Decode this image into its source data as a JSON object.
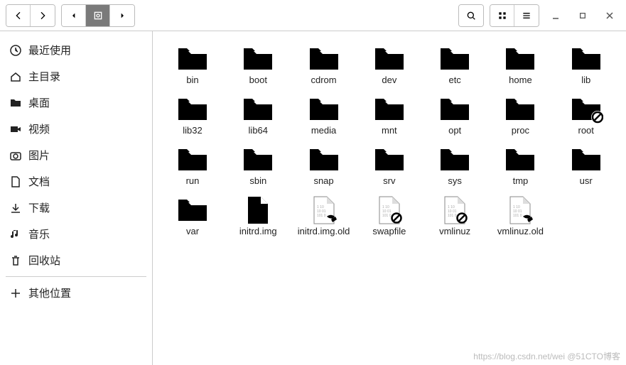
{
  "toolbar": {
    "back": "back",
    "forward": "forward",
    "path_prev": "prev",
    "path_current": "root",
    "path_next": "next",
    "search": "search",
    "view_grid": "grid",
    "menu": "menu",
    "minimize": "minimize",
    "maximize": "maximize",
    "close": "close"
  },
  "sidebar": {
    "items": [
      {
        "id": "recent",
        "icon": "clock",
        "label": "最近使用"
      },
      {
        "id": "home",
        "icon": "home",
        "label": "主目录"
      },
      {
        "id": "desktop",
        "icon": "folder",
        "label": "桌面"
      },
      {
        "id": "videos",
        "icon": "video",
        "label": "视频"
      },
      {
        "id": "pictures",
        "icon": "camera",
        "label": "图片"
      },
      {
        "id": "documents",
        "icon": "doc",
        "label": "文档"
      },
      {
        "id": "downloads",
        "icon": "download",
        "label": "下载"
      },
      {
        "id": "music",
        "icon": "music",
        "label": "音乐"
      },
      {
        "id": "trash",
        "icon": "trash",
        "label": "回收站"
      }
    ],
    "other": {
      "icon": "plus",
      "label": "其他位置"
    }
  },
  "files": [
    {
      "name": "bin",
      "type": "folder"
    },
    {
      "name": "boot",
      "type": "folder"
    },
    {
      "name": "cdrom",
      "type": "folder"
    },
    {
      "name": "dev",
      "type": "folder"
    },
    {
      "name": "etc",
      "type": "folder"
    },
    {
      "name": "home",
      "type": "folder"
    },
    {
      "name": "lib",
      "type": "folder"
    },
    {
      "name": "lib32",
      "type": "folder"
    },
    {
      "name": "lib64",
      "type": "folder"
    },
    {
      "name": "media",
      "type": "folder"
    },
    {
      "name": "mnt",
      "type": "folder"
    },
    {
      "name": "opt",
      "type": "folder"
    },
    {
      "name": "proc",
      "type": "folder"
    },
    {
      "name": "root",
      "type": "folder-restricted"
    },
    {
      "name": "run",
      "type": "folder"
    },
    {
      "name": "sbin",
      "type": "folder"
    },
    {
      "name": "snap",
      "type": "folder"
    },
    {
      "name": "srv",
      "type": "folder"
    },
    {
      "name": "sys",
      "type": "folder"
    },
    {
      "name": "tmp",
      "type": "folder"
    },
    {
      "name": "usr",
      "type": "folder"
    },
    {
      "name": "var",
      "type": "folder"
    },
    {
      "name": "initrd.img",
      "type": "file"
    },
    {
      "name": "initrd.img.old",
      "type": "file-link"
    },
    {
      "name": "swapfile",
      "type": "file-restricted"
    },
    {
      "name": "vmlinuz",
      "type": "file-restricted"
    },
    {
      "name": "vmlinuz.old",
      "type": "file-link"
    }
  ],
  "watermark": "https://blog.csdn.net/wei @51CTO博客"
}
